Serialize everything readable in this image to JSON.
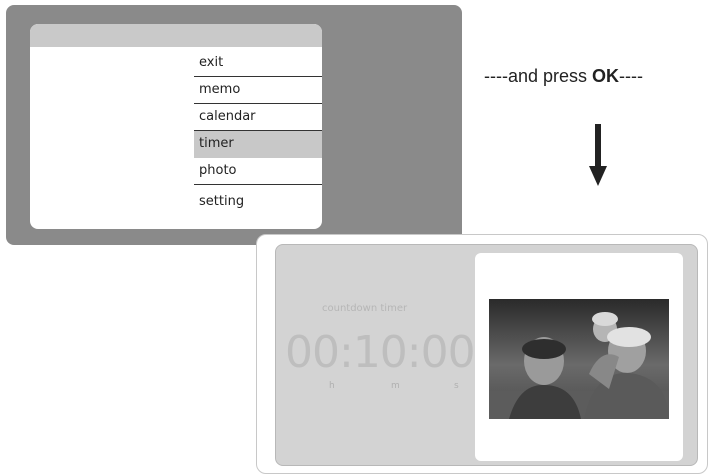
{
  "menu": {
    "items": [
      {
        "label": "exit"
      },
      {
        "label": "memo"
      },
      {
        "label": "calendar"
      },
      {
        "label": "timer",
        "selected": true
      },
      {
        "label": "photo"
      },
      {
        "label": "setting"
      }
    ]
  },
  "instruction": {
    "prefix": "----and press ",
    "key": "OK",
    "suffix": "----"
  },
  "timer": {
    "title": "countdown timer",
    "time": "00:10:00",
    "units": {
      "h": "h",
      "m": "m",
      "s": "s"
    }
  },
  "photo": {
    "description_icon": "family-photo-image"
  },
  "colors": {
    "menu_bg": "#8a8a8a",
    "selected": "#c8c8c8",
    "timer_bg": "#d3d3d3"
  }
}
